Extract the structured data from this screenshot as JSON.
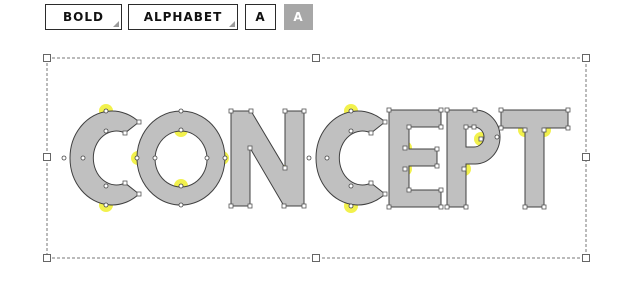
{
  "toolbar": {
    "weight_label": "BOLD",
    "charset_label": "ALPHABET",
    "outline_mode_label": "A",
    "filled_mode_label": "A"
  },
  "canvas": {
    "word": "CONCEPT",
    "letters": [
      "C",
      "O",
      "N",
      "C",
      "E",
      "P",
      "T"
    ],
    "colors": {
      "glyph_fill": "#c0c0c0",
      "glyph_stroke": "#404040",
      "highlight": "#f1ef3a",
      "selection_border": "#777777"
    }
  }
}
